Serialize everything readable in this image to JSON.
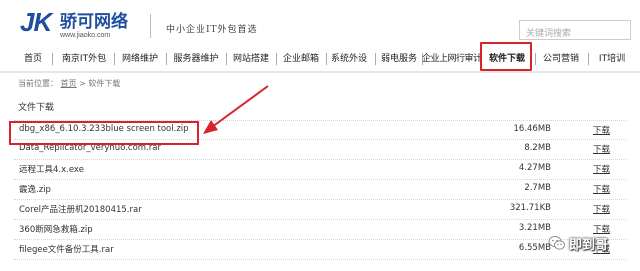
{
  "header": {
    "logo_jk": "JK",
    "logo_cn": "骄可网络",
    "logo_url": "www.jiaoko.com",
    "slogan": "中小企业IT外包首选",
    "search_placeholder": "关键词搜索"
  },
  "nav": {
    "items": [
      {
        "label": "首页"
      },
      {
        "label": "南京IT外包"
      },
      {
        "label": "网络维护"
      },
      {
        "label": "服务器维护"
      },
      {
        "label": "网站搭建"
      },
      {
        "label": "企业邮箱"
      },
      {
        "label": "系统外设"
      },
      {
        "label": "弱电服务"
      },
      {
        "label": "企业上网行审计"
      },
      {
        "label": "软件下载"
      },
      {
        "label": "公司营销"
      },
      {
        "label": "IT培训"
      }
    ],
    "active_index": 9
  },
  "breadcrumb": {
    "prefix": "当前位置：",
    "home": "首页",
    "separator": ">",
    "current": "软件下载"
  },
  "section_title": "文件下载",
  "files": [
    {
      "name": "dbg_x86_6.10.3.233blue screen tool.zip",
      "size": "16.46MB",
      "action": "下载"
    },
    {
      "name": "Data_Replicator_veryhuo.com.rar",
      "size": "8.2MB",
      "action": "下载"
    },
    {
      "name": "远程工具4.x.exe",
      "size": "4.27MB",
      "action": "下载"
    },
    {
      "name": "霰逸.zip",
      "size": "2.7MB",
      "action": "下载"
    },
    {
      "name": "Corel产品注册机20180415.rar",
      "size": "321.71KB",
      "action": "下载"
    },
    {
      "name": "360断网急救箱.zip",
      "size": "3.21MB",
      "action": "下载"
    },
    {
      "name": "filegee文件备份工具.rar",
      "size": "6.55MB",
      "action": "下载"
    }
  ],
  "watermark": {
    "text": "即到哥"
  },
  "colors": {
    "brand_blue": "#1f4f9c",
    "highlight_red": "#d9232b"
  }
}
